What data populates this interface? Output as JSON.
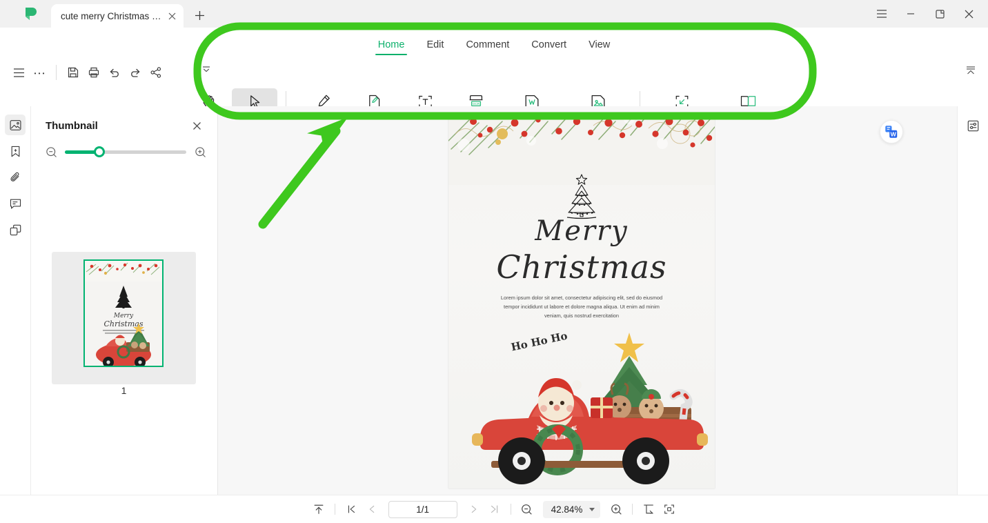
{
  "window": {
    "tab_title": "cute merry Christmas wi...",
    "new_tab_label": "+",
    "controls": {
      "menu": "☰",
      "minimize": "—",
      "restore": "❐",
      "close": "✕"
    }
  },
  "quick_access": {
    "items": [
      {
        "name": "main-menu",
        "label": "☰"
      },
      {
        "name": "more-options",
        "label": "…"
      },
      {
        "name": "save",
        "label": "save-icon"
      },
      {
        "name": "print",
        "label": "print-icon"
      },
      {
        "name": "undo",
        "label": "undo-icon"
      },
      {
        "name": "redo",
        "label": "redo-icon"
      },
      {
        "name": "share",
        "label": "share-icon"
      }
    ]
  },
  "ribbon": {
    "tabs": [
      {
        "label": "Home",
        "active": true
      },
      {
        "label": "Edit",
        "active": false
      },
      {
        "label": "Comment",
        "active": false
      },
      {
        "label": "Convert",
        "active": false
      },
      {
        "label": "View",
        "active": false
      }
    ],
    "tools": [
      {
        "label": "Hand",
        "icon": "hand-icon",
        "selected": false
      },
      {
        "label": "Select",
        "icon": "cursor-arrow-icon",
        "selected": true
      },
      {
        "label": "Highlight",
        "icon": "highlighter-pen-icon",
        "selected": false
      },
      {
        "label": "Edit",
        "icon": "edit-document-icon",
        "selected": false
      },
      {
        "label": "Add Text",
        "icon": "add-text-icon",
        "selected": false
      },
      {
        "label": "OCR",
        "icon": "ocr-icon",
        "selected": false
      },
      {
        "label": "To Office",
        "icon": "to-word-icon",
        "selected": false
      },
      {
        "label": "To Image",
        "icon": "to-image-icon",
        "selected": false
      },
      {
        "label": "Full Screen",
        "icon": "fullscreen-icon",
        "selected": false
      },
      {
        "label": "Read Mode",
        "icon": "book-open-icon",
        "selected": false
      }
    ],
    "accent_color": "#0cb06b"
  },
  "left_rail": {
    "items": [
      {
        "name": "thumbnail-panel",
        "icon": "thumbnail-icon",
        "active": true
      },
      {
        "name": "bookmark-panel",
        "icon": "bookmark-icon",
        "active": false
      },
      {
        "name": "attachment-panel",
        "icon": "paperclip-icon",
        "active": false
      },
      {
        "name": "comment-panel",
        "icon": "comment-icon",
        "active": false
      },
      {
        "name": "layers-panel",
        "icon": "layers-icon",
        "active": false
      }
    ]
  },
  "thumbnail_panel": {
    "title": "Thumbnail",
    "close_label": "✕",
    "zoom_out_icon": "zoom-out-icon",
    "zoom_in_icon": "zoom-in-icon",
    "slider_value_percent": 27,
    "pages": [
      {
        "number": "1",
        "selected": true
      }
    ]
  },
  "document": {
    "heading_line1": "Merry",
    "heading_line2": "Christmas",
    "body_text": "Lorem ipsum dolor sit amet, consectetur adipiscing elit, sed do eiusmod tempor incididunt ut labore et dolore magna aliqua. Ut enim ad minim veniam, quis nostrud exercitation",
    "sticker_text": "Ho Ho Ho"
  },
  "right_rail": {
    "collapse_ribbon_icon": "collapse-ribbon-icon",
    "properties_icon": "properties-sliders-icon",
    "convert_badge_icon": "convert-to-word-icon"
  },
  "status_bar": {
    "scroll_top_icon": "scroll-to-top-icon",
    "first_page_icon": "first-page-icon",
    "prev_page_icon": "previous-page-icon",
    "page_indicator": "1/1",
    "next_page_icon": "next-page-icon",
    "last_page_icon": "last-page-icon",
    "zoom_out_icon": "zoom-out-icon",
    "zoom_level": "42.84%",
    "zoom_in_icon": "zoom-in-icon",
    "fit_width_icon": "fit-width-icon",
    "fit_page_icon": "fit-page-icon"
  },
  "annotation": {
    "color": "#3ec81e",
    "shapes": [
      "rounded-rectangle-highlight",
      "arrow-pointing-to-toolbar"
    ]
  }
}
